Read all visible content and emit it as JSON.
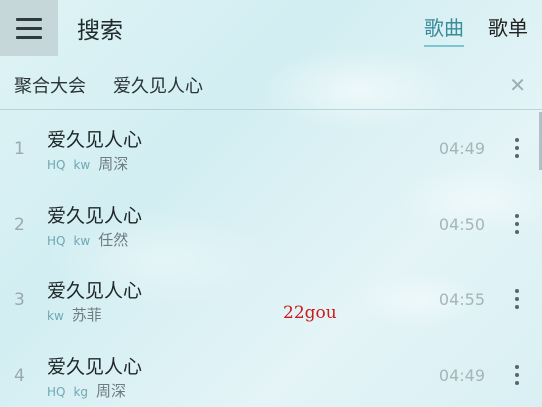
{
  "header": {
    "title": "搜索",
    "tabs": [
      {
        "label": "歌曲",
        "active": true
      },
      {
        "label": "歌单",
        "active": false
      }
    ]
  },
  "search": {
    "source_label": "聚合大会",
    "query": "爱久见人心"
  },
  "results": [
    {
      "index": "1",
      "title": "爱久见人心",
      "tags": [
        "HQ",
        "kw"
      ],
      "artist": "周深",
      "duration": "04:49"
    },
    {
      "index": "2",
      "title": "爱久见人心",
      "tags": [
        "HQ",
        "kw"
      ],
      "artist": "任然",
      "duration": "04:50"
    },
    {
      "index": "3",
      "title": "爱久见人心",
      "tags": [
        "kw"
      ],
      "artist": "苏菲",
      "duration": "04:55"
    },
    {
      "index": "4",
      "title": "爱久见人心",
      "tags": [
        "HQ",
        "kg"
      ],
      "artist": "周深",
      "duration": "04:49"
    }
  ],
  "watermark": "22gou",
  "icons": {
    "menu": "hamburger-menu-icon",
    "clear": "close-icon",
    "more": "more-vertical-icon"
  },
  "colors": {
    "accent": "#3a8c9a",
    "watermark": "#cc1a1a"
  }
}
